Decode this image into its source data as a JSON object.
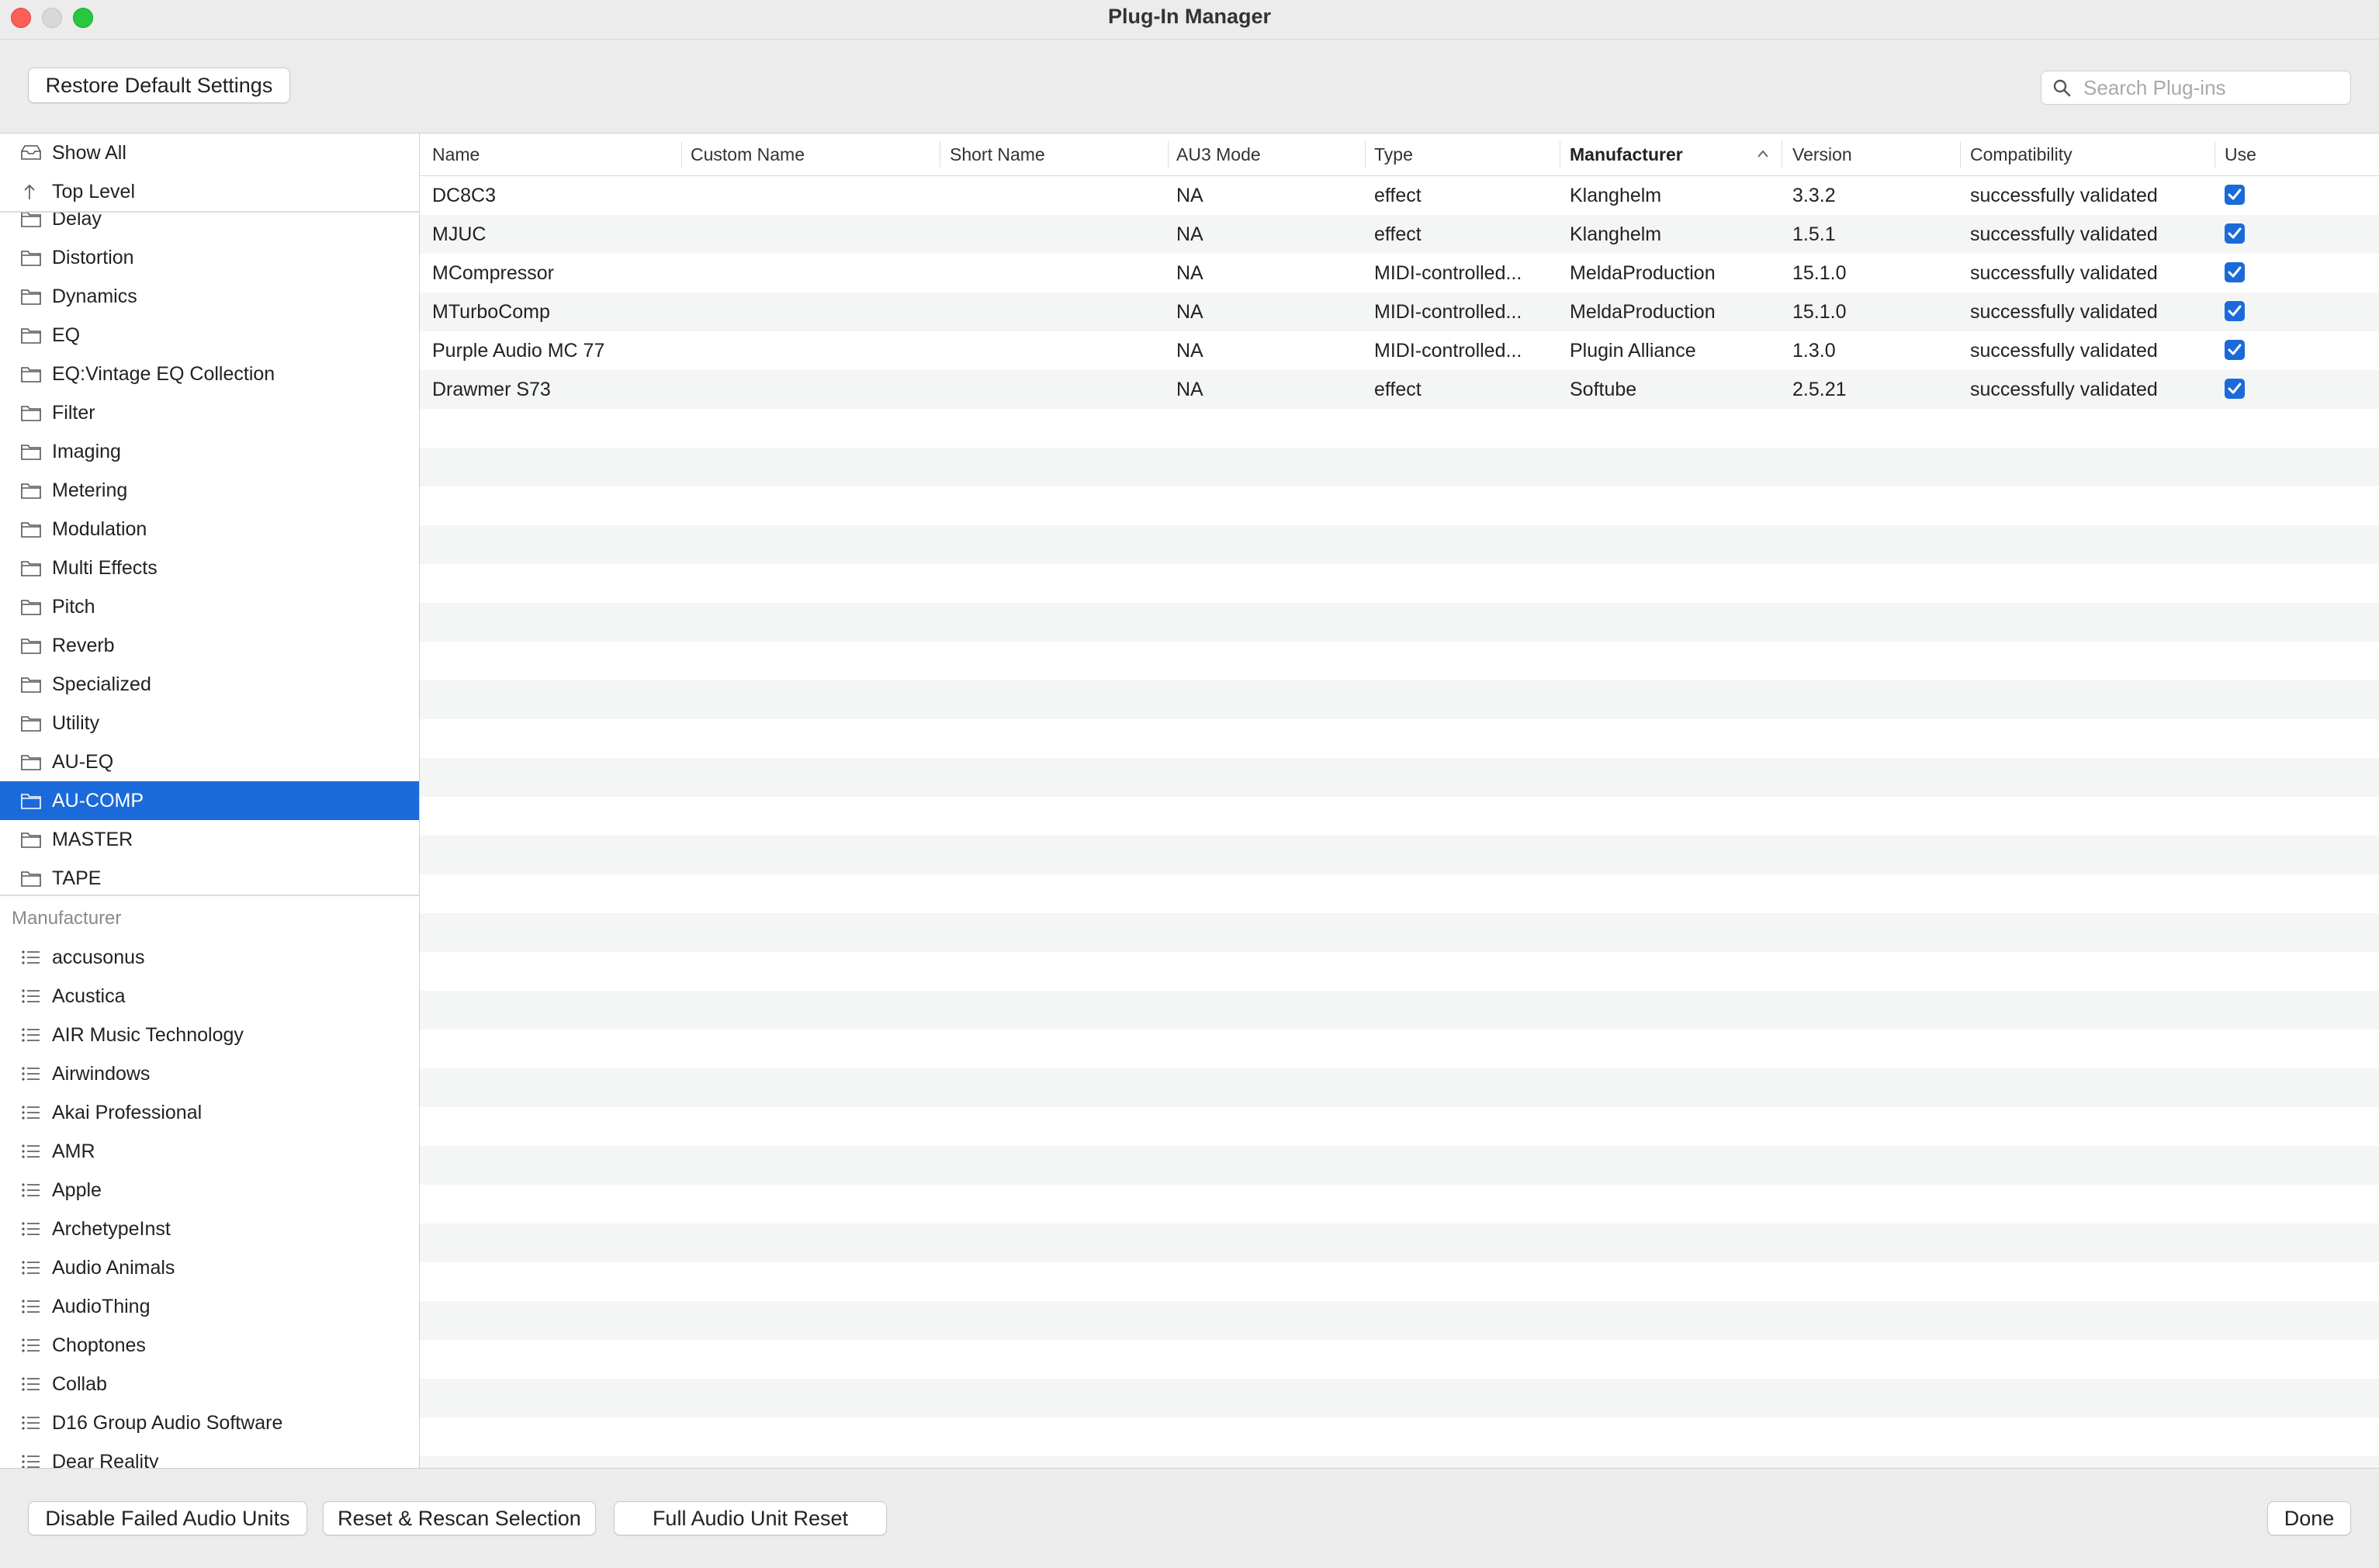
{
  "window": {
    "title": "Plug-In Manager"
  },
  "toolbar": {
    "restore_label": "Restore Default Settings",
    "search_placeholder": "Search Plug-ins"
  },
  "sidebar": {
    "top_items": [
      {
        "label": "Show All",
        "icon": "show-all-icon"
      },
      {
        "label": "Top Level",
        "icon": "arrow-up-icon"
      }
    ],
    "categories": [
      {
        "label": "Delay"
      },
      {
        "label": "Distortion"
      },
      {
        "label": "Dynamics"
      },
      {
        "label": "EQ"
      },
      {
        "label": "EQ:Vintage EQ Collection"
      },
      {
        "label": "Filter"
      },
      {
        "label": "Imaging"
      },
      {
        "label": "Metering"
      },
      {
        "label": "Modulation"
      },
      {
        "label": "Multi Effects"
      },
      {
        "label": "Pitch"
      },
      {
        "label": "Reverb"
      },
      {
        "label": "Specialized"
      },
      {
        "label": "Utility"
      },
      {
        "label": "AU-EQ"
      },
      {
        "label": "AU-COMP",
        "selected": true
      },
      {
        "label": "MASTER"
      },
      {
        "label": "TAPE"
      }
    ],
    "manufacturer_header": "Manufacturer",
    "manufacturers": [
      {
        "label": "accusonus"
      },
      {
        "label": "Acustica"
      },
      {
        "label": "AIR Music Technology"
      },
      {
        "label": "Airwindows"
      },
      {
        "label": "Akai Professional"
      },
      {
        "label": "AMR"
      },
      {
        "label": "Apple"
      },
      {
        "label": "ArchetypeInst"
      },
      {
        "label": "Audio Animals"
      },
      {
        "label": "AudioThing"
      },
      {
        "label": "Choptones"
      },
      {
        "label": "Collab"
      },
      {
        "label": "D16 Group Audio Software"
      },
      {
        "label": "Dear Reality"
      }
    ],
    "selected_color": "#1a6bd9"
  },
  "table": {
    "columns": {
      "name": "Name",
      "custom_name": "Custom Name",
      "short_name": "Short Name",
      "au3_mode": "AU3 Mode",
      "type": "Type",
      "manufacturer": "Manufacturer",
      "version": "Version",
      "compatibility": "Compatibility",
      "use": "Use"
    },
    "sorted_by": "Manufacturer",
    "rows": [
      {
        "name": "DC8C3",
        "custom_name": "",
        "short_name": "",
        "au3_mode": "NA",
        "type": "effect",
        "manufacturer": "Klanghelm",
        "version": "3.3.2",
        "compatibility": "successfully validated",
        "use": true
      },
      {
        "name": "MJUC",
        "custom_name": "",
        "short_name": "",
        "au3_mode": "NA",
        "type": "effect",
        "manufacturer": "Klanghelm",
        "version": "1.5.1",
        "compatibility": "successfully validated",
        "use": true
      },
      {
        "name": "MCompressor",
        "custom_name": "",
        "short_name": "",
        "au3_mode": "NA",
        "type": "MIDI-controlled...",
        "manufacturer": "MeldaProduction",
        "version": "15.1.0",
        "compatibility": "successfully validated",
        "use": true
      },
      {
        "name": "MTurboComp",
        "custom_name": "",
        "short_name": "",
        "au3_mode": "NA",
        "type": "MIDI-controlled...",
        "manufacturer": "MeldaProduction",
        "version": "15.1.0",
        "compatibility": "successfully validated",
        "use": true
      },
      {
        "name": "Purple Audio MC 77",
        "custom_name": "",
        "short_name": "",
        "au3_mode": "NA",
        "type": "MIDI-controlled...",
        "manufacturer": "Plugin Alliance",
        "version": "1.3.0",
        "compatibility": "successfully validated",
        "use": true
      },
      {
        "name": "Drawmer S73",
        "custom_name": "",
        "short_name": "",
        "au3_mode": "NA",
        "type": "effect",
        "manufacturer": "Softube",
        "version": "2.5.21",
        "compatibility": "successfully validated",
        "use": true
      }
    ],
    "check_color": "#1a6bd9"
  },
  "bottom": {
    "disable_failed_label": "Disable Failed Audio Units",
    "reset_rescan_label": "Reset & Rescan Selection",
    "full_reset_label": "Full Audio Unit Reset",
    "done_label": "Done"
  }
}
